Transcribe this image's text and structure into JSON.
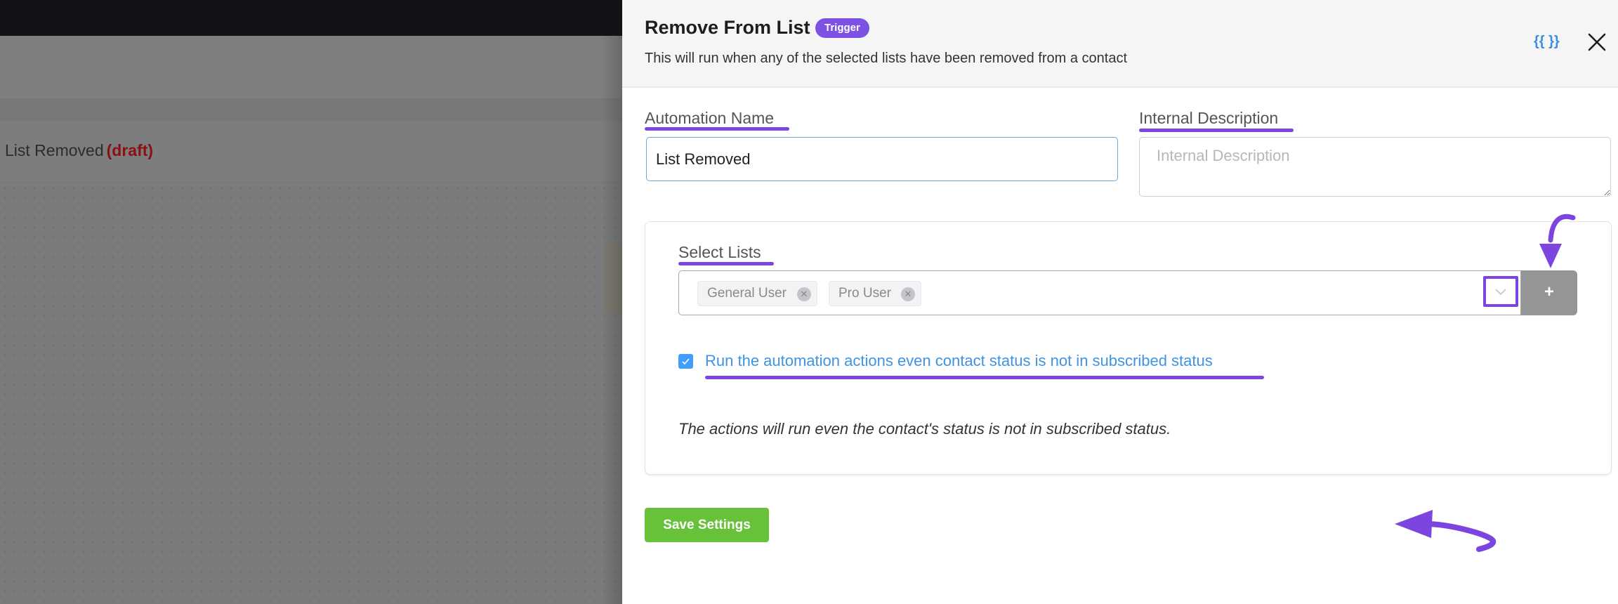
{
  "background": {
    "automation_title": "List Removed",
    "status_label": "(draft)"
  },
  "drawer": {
    "title": "Remove From List",
    "badge": "Trigger",
    "subtitle": "This will run when any of the selected lists have been removed from a contact",
    "smartcode_label": "{{ }}",
    "close_icon": "close-icon"
  },
  "form": {
    "automation_name": {
      "label": "Automation Name",
      "value": "List Removed"
    },
    "internal_description": {
      "label": "Internal Description",
      "placeholder": "Internal Description",
      "value": ""
    },
    "select_lists": {
      "label": "Select Lists",
      "selected": [
        {
          "label": "General User"
        },
        {
          "label": "Pro User"
        }
      ],
      "chevron_icon": "chevron-down-icon",
      "add_label": "+"
    },
    "run_even_unsubscribed": {
      "checked": true,
      "label": "Run the automation actions even contact status is not in subscribed status",
      "note": "The actions will run even the contact's status is not in subscribed status."
    },
    "save_label": "Save Settings"
  },
  "colors": {
    "accent_purple": "#7c45e0",
    "badge_purple": "#7b52e3",
    "link_blue": "#3f93e3",
    "save_green": "#67c23a",
    "draft_red": "#8d1010"
  }
}
